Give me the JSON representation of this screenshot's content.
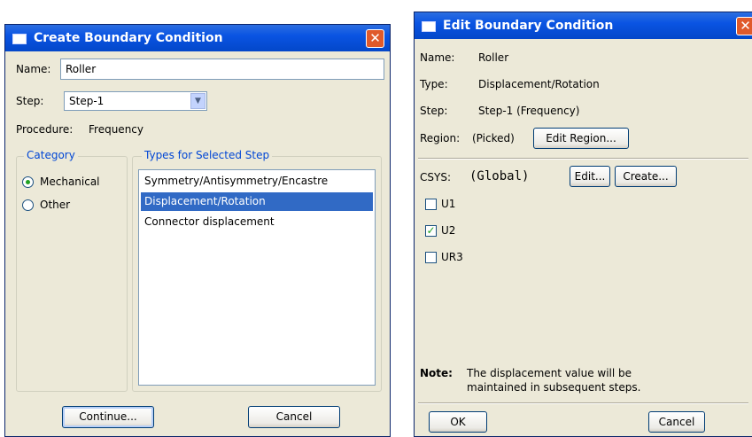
{
  "create_dialog": {
    "title": "Create Boundary Condition",
    "name_label": "Name:",
    "name_value": "Roller",
    "step_label": "Step:",
    "step_value": "Step-1",
    "procedure_label": "Procedure:",
    "procedure_value": "Frequency",
    "category": {
      "legend": "Category",
      "options": [
        {
          "label": "Mechanical",
          "selected": true
        },
        {
          "label": "Other",
          "selected": false
        }
      ]
    },
    "types": {
      "legend": "Types for Selected Step",
      "items": [
        {
          "label": "Symmetry/Antisymmetry/Encastre",
          "selected": false
        },
        {
          "label": "Displacement/Rotation",
          "selected": true
        },
        {
          "label": "Connector displacement",
          "selected": false
        }
      ]
    },
    "continue_label": "Continue...",
    "cancel_label": "Cancel"
  },
  "edit_dialog": {
    "title": "Edit Boundary Condition",
    "name_label": "Name:",
    "name_value": "Roller",
    "type_label": "Type:",
    "type_value": "Displacement/Rotation",
    "step_label": "Step:",
    "step_value": "Step-1 (Frequency)",
    "region_label": "Region:",
    "region_value": "(Picked)",
    "edit_region_label": "Edit Region...",
    "csys_label": "CSYS:",
    "csys_value": "(Global)",
    "csys_edit_label": "Edit...",
    "csys_create_label": "Create...",
    "dofs": [
      {
        "label": "U1",
        "checked": false
      },
      {
        "label": "U2",
        "checked": true
      },
      {
        "label": "UR3",
        "checked": false
      }
    ],
    "note_label": "Note:",
    "note_line1": "The displacement value will be",
    "note_line2": "maintained in subsequent steps.",
    "ok_label": "OK",
    "cancel_label": "Cancel"
  },
  "colors": {
    "titlebar": "#0a54e3",
    "dialog_bg": "#ece9d8",
    "selection": "#316ac5",
    "legend_text": "#0046d5",
    "close_button": "#e05a2b"
  }
}
